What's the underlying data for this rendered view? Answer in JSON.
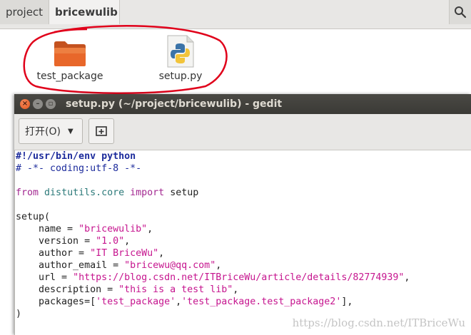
{
  "pathbar": {
    "crumbs": [
      "project",
      "bricewulib"
    ],
    "search_icon": "search-icon"
  },
  "files": [
    {
      "name": "test_package",
      "icon": "folder-icon",
      "color": "#e5662b"
    },
    {
      "name": "setup.py",
      "icon": "python-file-icon"
    }
  ],
  "annotation": {
    "color": "#e0001a"
  },
  "gedit": {
    "title": "setup.py (~/project/bricewulib) - gedit",
    "open_label": "打开(O)",
    "open_icon": "chevron-down-icon",
    "newtab_icon": "new-tab-icon",
    "code": {
      "shebang": "#!/usr/bin/env python",
      "coding": "# -*- coding:utf-8 -*-",
      "from_kw": "from",
      "module": "distutils.core",
      "import_kw": "import",
      "import_name": " setup",
      "setup_open": "setup(",
      "name_key": "    name = ",
      "name_val": "\"bricewulib\"",
      "version_key": "    version = ",
      "version_val": "\"1.0\"",
      "author_key": "    author = ",
      "author_val": "\"IT BriceWu\"",
      "email_key": "    author_email = ",
      "email_val": "\"bricewu@qq.com\"",
      "url_key": "    url = ",
      "url_val": "\"https://blog.csdn.net/ITBriceWu/article/details/82774939\"",
      "desc_key": "    description = ",
      "desc_val": "\"this is a test lib\"",
      "pkg_key": "    packages=[",
      "pkg_val1": "'test_package'",
      "pkg_sep": ",",
      "pkg_val2": "'test_package.test_package2'",
      "pkg_end": "],",
      "close": ")"
    }
  },
  "watermark": "https://blog.csdn.net/ITBriceWu"
}
